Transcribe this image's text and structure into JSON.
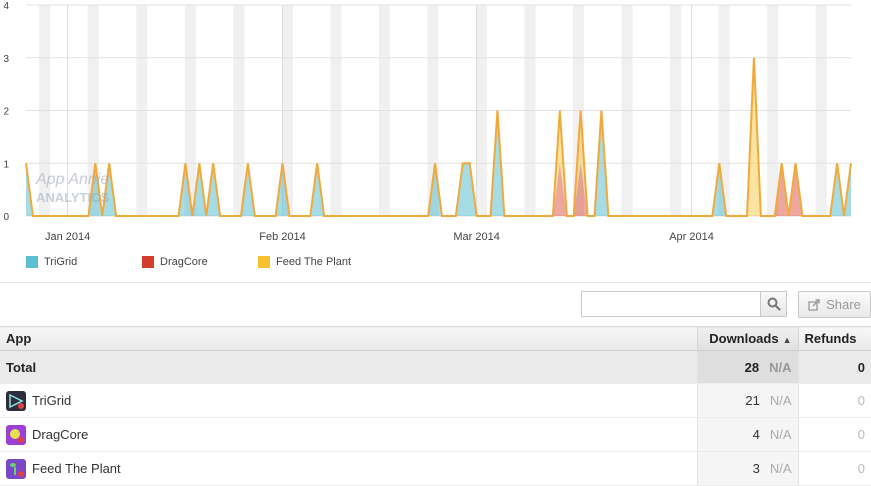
{
  "chart_data": {
    "type": "area",
    "stacked": true,
    "x": [
      "2013-12-26",
      "2013-12-27",
      "2013-12-28",
      "2013-12-29",
      "2013-12-30",
      "2013-12-31",
      "2014-01-01",
      "2014-01-02",
      "2014-01-03",
      "2014-01-04",
      "2014-01-05",
      "2014-01-06",
      "2014-01-07",
      "2014-01-08",
      "2014-01-09",
      "2014-01-10",
      "2014-01-11",
      "2014-01-12",
      "2014-01-13",
      "2014-01-14",
      "2014-01-15",
      "2014-01-16",
      "2014-01-17",
      "2014-01-18",
      "2014-01-19",
      "2014-01-20",
      "2014-01-21",
      "2014-01-22",
      "2014-01-23",
      "2014-01-24",
      "2014-01-25",
      "2014-01-26",
      "2014-01-27",
      "2014-01-28",
      "2014-01-29",
      "2014-01-30",
      "2014-01-31",
      "2014-02-01",
      "2014-02-02",
      "2014-02-03",
      "2014-02-04",
      "2014-02-05",
      "2014-02-06",
      "2014-02-07",
      "2014-02-08",
      "2014-02-09",
      "2014-02-10",
      "2014-02-11",
      "2014-02-12",
      "2014-02-13",
      "2014-02-14",
      "2014-02-15",
      "2014-02-16",
      "2014-02-17",
      "2014-02-18",
      "2014-02-19",
      "2014-02-20",
      "2014-02-21",
      "2014-02-22",
      "2014-02-23",
      "2014-02-24",
      "2014-02-25",
      "2014-02-26",
      "2014-02-27",
      "2014-02-28",
      "2014-03-01",
      "2014-03-02",
      "2014-03-03",
      "2014-03-04",
      "2014-03-05",
      "2014-03-06",
      "2014-03-07",
      "2014-03-08",
      "2014-03-09",
      "2014-03-10",
      "2014-03-11",
      "2014-03-12",
      "2014-03-13",
      "2014-03-14",
      "2014-03-15",
      "2014-03-16",
      "2014-03-17",
      "2014-03-18",
      "2014-03-19",
      "2014-03-20",
      "2014-03-21",
      "2014-03-22",
      "2014-03-23",
      "2014-03-24",
      "2014-03-25",
      "2014-03-26",
      "2014-03-27",
      "2014-03-28",
      "2014-03-29",
      "2014-03-30",
      "2014-03-31",
      "2014-04-01",
      "2014-04-02",
      "2014-04-03",
      "2014-04-04",
      "2014-04-05",
      "2014-04-06",
      "2014-04-07",
      "2014-04-08",
      "2014-04-09",
      "2014-04-10",
      "2014-04-11",
      "2014-04-12",
      "2014-04-13",
      "2014-04-14",
      "2014-04-15",
      "2014-04-16",
      "2014-04-17",
      "2014-04-18",
      "2014-04-19",
      "2014-04-20",
      "2014-04-21",
      "2014-04-22",
      "2014-04-23",
      "2014-04-24"
    ],
    "series": [
      {
        "name": "TriGrid",
        "color": "#5bc0cf",
        "values": [
          1,
          0,
          0,
          0,
          0,
          0,
          0,
          0,
          0,
          0,
          1,
          0,
          1,
          0,
          0,
          0,
          0,
          0,
          0,
          0,
          0,
          0,
          0,
          1,
          0,
          1,
          0,
          1,
          0,
          0,
          0,
          0,
          1,
          0,
          0,
          0,
          0,
          1,
          0,
          0,
          0,
          0,
          1,
          0,
          0,
          0,
          0,
          0,
          0,
          0,
          0,
          0,
          0,
          0,
          0,
          0,
          0,
          0,
          0,
          1,
          0,
          0,
          0,
          1,
          1,
          0,
          0,
          0,
          2,
          0,
          0,
          0,
          0,
          0,
          0,
          0,
          0,
          0,
          0,
          0,
          0,
          0,
          0,
          2,
          0,
          0,
          0,
          0,
          0,
          0,
          0,
          0,
          0,
          0,
          0,
          0,
          0,
          0,
          0,
          0,
          1,
          0,
          0,
          0,
          0,
          0,
          0,
          0,
          0,
          0,
          0,
          0,
          0,
          0,
          0,
          0,
          0,
          1,
          0,
          1
        ]
      },
      {
        "name": "DragCore",
        "color": "#d43d2a",
        "values": [
          0,
          0,
          0,
          0,
          0,
          0,
          0,
          0,
          0,
          0,
          0,
          0,
          0,
          0,
          0,
          0,
          0,
          0,
          0,
          0,
          0,
          0,
          0,
          0,
          0,
          0,
          0,
          0,
          0,
          0,
          0,
          0,
          0,
          0,
          0,
          0,
          0,
          0,
          0,
          0,
          0,
          0,
          0,
          0,
          0,
          0,
          0,
          0,
          0,
          0,
          0,
          0,
          0,
          0,
          0,
          0,
          0,
          0,
          0,
          0,
          0,
          0,
          0,
          0,
          0,
          0,
          0,
          0,
          0,
          0,
          0,
          0,
          0,
          0,
          0,
          0,
          0,
          0,
          0,
          0,
          0,
          0,
          0,
          0,
          0,
          0,
          0,
          0,
          0,
          0,
          0,
          0,
          0,
          0,
          0,
          0,
          0,
          0,
          0,
          0,
          0,
          0,
          0,
          0,
          0,
          0,
          0,
          0,
          0,
          0,
          0,
          0,
          0,
          0,
          0,
          0,
          0,
          0,
          0,
          0
        ]
      },
      {
        "name": "Feed The Plant",
        "color": "#f7c02e",
        "values": [
          0,
          0,
          0,
          0,
          0,
          0,
          0,
          0,
          0,
          0,
          0,
          0,
          0,
          0,
          0,
          0,
          0,
          0,
          0,
          0,
          0,
          0,
          0,
          0,
          0,
          0,
          0,
          0,
          0,
          0,
          0,
          0,
          0,
          0,
          0,
          0,
          0,
          0,
          0,
          0,
          0,
          0,
          0,
          0,
          0,
          0,
          0,
          0,
          0,
          0,
          0,
          0,
          0,
          0,
          0,
          0,
          0,
          0,
          0,
          0,
          0,
          0,
          0,
          0,
          0,
          0,
          0,
          0,
          0,
          0,
          0,
          0,
          0,
          0,
          0,
          0,
          0,
          0,
          0,
          0,
          0,
          0,
          0,
          0,
          0,
          0,
          0,
          0,
          0,
          0,
          0,
          0,
          0,
          0,
          0,
          0,
          0,
          0,
          0,
          0,
          0,
          0,
          0,
          0,
          0,
          0,
          0,
          0,
          0,
          0,
          0,
          0,
          0,
          0,
          0,
          0,
          0,
          0,
          0,
          0
        ]
      }
    ],
    "spikes": {
      "TriGrid": [
        [
          0,
          1
        ],
        [
          10,
          1
        ],
        [
          12,
          1
        ],
        [
          23,
          1
        ],
        [
          25,
          1
        ],
        [
          27,
          1
        ],
        [
          32,
          1
        ],
        [
          37,
          1
        ],
        [
          42,
          1
        ],
        [
          59,
          1
        ],
        [
          63,
          1
        ],
        [
          64,
          1
        ],
        [
          68,
          2
        ],
        [
          83,
          2
        ],
        [
          100,
          1
        ],
        [
          117,
          1
        ],
        [
          119,
          1
        ]
      ],
      "DragCore": [
        [
          77,
          1
        ],
        [
          80,
          1
        ],
        [
          109,
          1
        ],
        [
          111,
          1
        ]
      ],
      "Feed The Plant": [
        [
          68,
          0
        ],
        [
          77,
          1
        ],
        [
          80,
          1
        ],
        [
          105,
          3
        ]
      ]
    },
    "ylim": [
      0,
      4
    ],
    "yticks": [
      "0",
      "1",
      "2",
      "3",
      "4"
    ],
    "xticks": [
      {
        "label": "Jan 2014",
        "date": "2014-01-01"
      },
      {
        "label": "Feb 2014",
        "date": "2014-02-01"
      },
      {
        "label": "Mar 2014",
        "date": "2014-03-01"
      },
      {
        "label": "Apr 2014",
        "date": "2014-04-01"
      }
    ],
    "grid": true,
    "legend_position": "bottom-left"
  },
  "watermark": {
    "line1": "App Annie",
    "line2": "ANALYTICS"
  },
  "legend": [
    {
      "name": "TriGrid",
      "color": "#5bc0cf"
    },
    {
      "name": "DragCore",
      "color": "#d43d2a"
    },
    {
      "name": "Feed The Plant",
      "color": "#f7c02e"
    }
  ],
  "search": {
    "placeholder": ""
  },
  "share_label": "Share",
  "table": {
    "headers": {
      "app": "App",
      "downloads": "Downloads",
      "refunds": "Refunds"
    },
    "total": {
      "label": "Total",
      "downloads": "28",
      "downloads_na": "N/A",
      "refunds": "0"
    },
    "rows": [
      {
        "name": "TriGrid",
        "downloads": "21",
        "na": "N/A",
        "refunds": "0",
        "icon": "trigrid-icon"
      },
      {
        "name": "DragCore",
        "downloads": "4",
        "na": "N/A",
        "refunds": "0",
        "icon": "dragcore-icon"
      },
      {
        "name": "Feed The Plant",
        "downloads": "3",
        "na": "N/A",
        "refunds": "0",
        "icon": "feed-the-plant-icon"
      }
    ]
  }
}
